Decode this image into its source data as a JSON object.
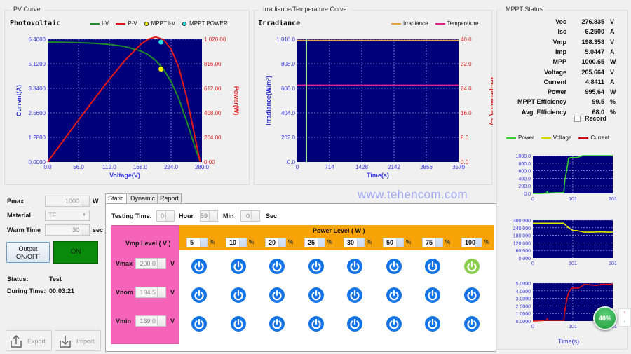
{
  "watermark": "www.tehencom.com",
  "pv_curve": {
    "group_title": "PV Curve",
    "chart_title": "Photovoltaic",
    "legend": [
      {
        "label": "I-V",
        "color": "#1f8a2a",
        "kind": "line"
      },
      {
        "label": "P-V",
        "color": "#e01818",
        "kind": "line"
      },
      {
        "label": "MPPT I-V",
        "color": "#f0f000",
        "kind": "dot"
      },
      {
        "label": "MPPT POWER",
        "color": "#20e0e0",
        "kind": "dot"
      }
    ]
  },
  "irr_curve": {
    "group_title": "Irradiance/Temperature Curve",
    "chart_title": "Irradiance",
    "legend": [
      {
        "label": "Irradiance",
        "color": "#e8a040"
      },
      {
        "label": "Temperature",
        "color": "#e0208a"
      }
    ]
  },
  "mppt_status": {
    "group_title": "MPPT Status",
    "rows": [
      {
        "label": "Voc",
        "value": "276.835",
        "unit": "V"
      },
      {
        "label": "Isc",
        "value": "6.2500",
        "unit": "A"
      },
      {
        "label": "Vmp",
        "value": "198.358",
        "unit": "V"
      },
      {
        "label": "Imp",
        "value": "5.0447",
        "unit": "A"
      },
      {
        "label": "MPP",
        "value": "1000.65",
        "unit": "W"
      },
      {
        "label": "Voltage",
        "value": "205.664",
        "unit": "V"
      },
      {
        "label": "Current",
        "value": "4.8411",
        "unit": "A"
      },
      {
        "label": "Power",
        "value": "995.64",
        "unit": "W"
      },
      {
        "label": "MPPT Efficiency",
        "value": "99.5",
        "unit": "%"
      },
      {
        "label": "Avg. Efficiency",
        "value": "68.0",
        "unit": "%"
      }
    ],
    "record_label": "Record",
    "record_checked": false,
    "legend": [
      {
        "label": "Power",
        "color": "#30d030"
      },
      {
        "label": "Voltage",
        "color": "#d8d800"
      },
      {
        "label": "Current",
        "color": "#d01010"
      }
    ],
    "time_axis_label": "Time(s)"
  },
  "controls": {
    "pmax_label": "Pmax",
    "pmax_value": "1000",
    "pmax_unit": "W",
    "material_label": "Material",
    "material_value": "TF",
    "warm_label": "Warm Time",
    "warm_value": "30",
    "warm_unit": "sec",
    "output_button": "Output ON/OFF",
    "on_indicator": "ON",
    "status_label": "Status:",
    "status_value": "Test",
    "during_label": "During Time:",
    "during_value": "00:03:21",
    "export_label": "Export",
    "import_label": "Import"
  },
  "tabs": [
    {
      "label": "Static",
      "active": true
    },
    {
      "label": "Dynamic",
      "active": false
    },
    {
      "label": "Report",
      "active": false
    }
  ],
  "static": {
    "testing_time_label": "Testing Time:",
    "hour_value": "0",
    "hour_label": "Hour",
    "min_value": "59",
    "min_label": "Min",
    "sec_value": "0",
    "sec_label": "Sec",
    "vmp_header": "Vmp Level ( V )",
    "power_header": "Power Level ( W )",
    "power_levels": [
      "5",
      "10",
      "20",
      "25",
      "30",
      "50",
      "75",
      "100"
    ],
    "pct_unit": "%",
    "vmp_rows": [
      {
        "label": "Vmax",
        "value": "200.0",
        "unit": "V"
      },
      {
        "label": "Vnom",
        "value": "194.5",
        "unit": "V"
      },
      {
        "label": "Vmin",
        "value": "189.0",
        "unit": "V"
      }
    ],
    "active_cell": {
      "row": 0,
      "col": 7
    }
  },
  "overlay_badge": "40%",
  "chart_data": [
    {
      "type": "line",
      "title": "Photovoltaic",
      "xlabel": "Voltage(V)",
      "ylabel": "Current(A)",
      "y2label": "Power(W)",
      "xlim": [
        0,
        280
      ],
      "ylim": [
        0,
        6.4
      ],
      "y2lim": [
        0,
        1020
      ],
      "xticks": [
        "0.0",
        "56.0",
        "112.0",
        "168.0",
        "224.0",
        "280.0"
      ],
      "yticks": [
        "0.0000",
        "1.2800",
        "2.5600",
        "3.8400",
        "5.1200",
        "6.4000"
      ],
      "y2ticks": [
        "0.00",
        "204.00",
        "408.00",
        "612.00",
        "816.00",
        "1,020.00"
      ],
      "grid": true,
      "series": [
        {
          "name": "I-V",
          "axis": "left",
          "x": [
            0,
            28,
            56,
            84,
            112,
            140,
            168,
            182,
            196,
            210,
            224,
            238,
            252,
            266,
            276.8
          ],
          "y": [
            6.25,
            6.24,
            6.22,
            6.19,
            6.13,
            6.02,
            5.8,
            5.6,
            5.3,
            4.85,
            4.2,
            3.3,
            2.15,
            0.9,
            0
          ]
        },
        {
          "name": "P-V",
          "axis": "right",
          "x": [
            0,
            28,
            56,
            84,
            112,
            140,
            168,
            182,
            196,
            210,
            224,
            238,
            252,
            266,
            276.8
          ],
          "y": [
            0,
            175,
            348,
            520,
            687,
            843,
            974,
            1019,
            1039,
            1018,
            941,
            785,
            542,
            239,
            0
          ]
        },
        {
          "name": "MPPT I-V",
          "axis": "left",
          "x": [
            205.7
          ],
          "y": [
            4.84
          ]
        },
        {
          "name": "MPPT POWER",
          "axis": "right",
          "x": [
            205.7
          ],
          "y": [
            995.6
          ]
        }
      ]
    },
    {
      "type": "line",
      "title": "Irradiance",
      "xlabel": "Time(s)",
      "ylabel": "Irradiance(W/m²)",
      "y2label": "Temperature(°C)",
      "xlim": [
        0,
        3570
      ],
      "ylim": [
        0,
        1010
      ],
      "y2lim": [
        0,
        40
      ],
      "xticks": [
        "0",
        "714",
        "1428",
        "2142",
        "2856",
        "3570"
      ],
      "yticks": [
        "0.0",
        "202.0",
        "404.0",
        "606.0",
        "808.0",
        "1,010.0"
      ],
      "y2ticks": [
        "0.0",
        "8.0",
        "16.0",
        "24.0",
        "32.0",
        "40.0"
      ],
      "grid": true,
      "series": [
        {
          "name": "Irradiance",
          "axis": "left",
          "x": [
            0,
            3570
          ],
          "y": [
            1000,
            1000
          ]
        },
        {
          "name": "Temperature",
          "axis": "right",
          "x": [
            0,
            3570
          ],
          "y": [
            25,
            25
          ]
        }
      ],
      "cursor_time": 201
    },
    {
      "type": "line",
      "title": "Power",
      "xlim": [
        0,
        201
      ],
      "ylim": [
        0,
        1000
      ],
      "xticks": [
        "0",
        "101",
        "201"
      ],
      "yticks": [
        "0.0",
        "200.0",
        "400.0",
        "600.0",
        "800.0",
        "1000.0"
      ],
      "series": [
        {
          "name": "Power",
          "x": [
            0,
            20,
            35,
            36,
            38,
            60,
            78,
            80,
            85,
            90,
            95,
            110,
            120,
            125,
            201
          ],
          "y": [
            0,
            0,
            10,
            70,
            10,
            20,
            20,
            320,
            600,
            930,
            950,
            950,
            980,
            1000,
            1000
          ]
        }
      ]
    },
    {
      "type": "line",
      "title": "Voltage",
      "xlim": [
        0,
        201
      ],
      "ylim": [
        0,
        300
      ],
      "xticks": [
        "0",
        "101",
        "201"
      ],
      "yticks": [
        "0.000",
        "60.000",
        "120.000",
        "180.000",
        "240.000",
        "300.000"
      ],
      "series": [
        {
          "name": "Voltage",
          "x": [
            0,
            77,
            90,
            101,
            110,
            130,
            150,
            170,
            185,
            201
          ],
          "y": [
            276,
            276,
            240,
            218,
            218,
            205,
            205,
            208,
            205,
            205
          ]
        }
      ]
    },
    {
      "type": "line",
      "title": "Current",
      "xlim": [
        0,
        201
      ],
      "ylim": [
        0,
        5
      ],
      "xticks": [
        "0",
        "101",
        "201"
      ],
      "yticks": [
        "0.0000",
        "1.0000",
        "2.0000",
        "3.0000",
        "4.0000",
        "5.0000"
      ],
      "xlabel": "Time(s)",
      "series": [
        {
          "name": "Current",
          "x": [
            0,
            20,
            35,
            36,
            38,
            60,
            78,
            80,
            85,
            90,
            97,
            101,
            115,
            130,
            160,
            175,
            201
          ],
          "y": [
            0,
            0.05,
            0.1,
            0.3,
            0.1,
            0.1,
            0.1,
            1.2,
            2.7,
            3.8,
            4.3,
            4.35,
            4.35,
            4.85,
            4.7,
            4.85,
            4.85
          ]
        }
      ]
    }
  ]
}
